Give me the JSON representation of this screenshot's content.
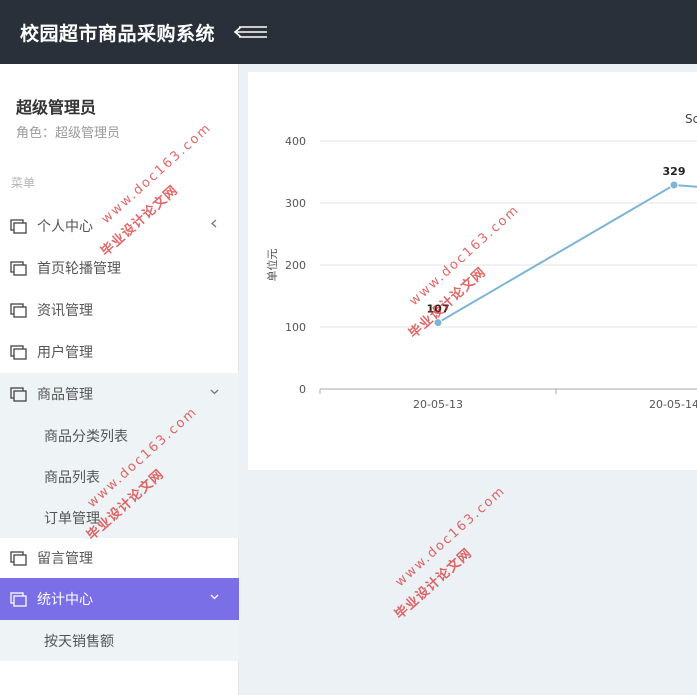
{
  "header": {
    "title": "校园超市商品采购系统",
    "menu_toggle_icon": "menu-collapse-icon"
  },
  "user": {
    "name": "超级管理员",
    "role": "角色：超级管理员"
  },
  "menu": {
    "header": "菜单",
    "items": [
      {
        "label": "个人中心",
        "icon": "menu-icon"
      },
      {
        "label": "首页轮播管理",
        "icon": "menu-icon"
      },
      {
        "label": "资讯管理",
        "icon": "menu-icon"
      },
      {
        "label": "用户管理",
        "icon": "menu-icon"
      },
      {
        "label": "商品管理",
        "icon": "menu-icon"
      },
      {
        "label": "留言管理",
        "icon": "menu-icon"
      },
      {
        "label": "统计中心",
        "icon": "menu-icon"
      }
    ],
    "goods_sub": [
      "商品分类列表",
      "商品列表",
      "订单管理"
    ],
    "stats_sub": [
      "按天销售额"
    ]
  },
  "chart_title": "Sc",
  "chart_data": {
    "type": "line",
    "title": "Sc",
    "ylabel": "单位元",
    "xlabel": "",
    "categories": [
      "20-05-13",
      "20-05-14"
    ],
    "series": [
      {
        "values": [
          107,
          329,
          300
        ]
      }
    ],
    "yticks": [
      "400",
      "300",
      "200",
      "100",
      "0"
    ],
    "ylim": [
      0,
      400
    ],
    "grid": true,
    "line_color": "#7eb4d8"
  },
  "watermarks": {
    "text": "毕业设计论文网",
    "url": "www.doc163.com"
  },
  "colors": {
    "topbar": "#2a3039",
    "active": "#7b6fe8",
    "submenu": "#eef3f6",
    "watermark": "#d72d2d"
  }
}
